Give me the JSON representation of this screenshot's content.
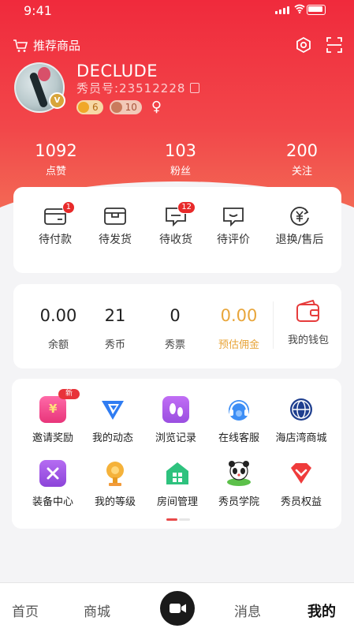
{
  "status_bar": {
    "time": "9:41"
  },
  "header": {
    "recommend_label": "推荐商品"
  },
  "profile": {
    "username": "DECLUDE",
    "id_label": "秀员号:23512228",
    "level_badge": "V",
    "mic_count": "6",
    "diamond_count": "10",
    "gender_symbol": "♀"
  },
  "stats": [
    {
      "value": "1092",
      "label": "点赞"
    },
    {
      "value": "103",
      "label": "粉丝"
    },
    {
      "value": "200",
      "label": "关注"
    }
  ],
  "orders": [
    {
      "label": "待付款",
      "badge": "1",
      "icon": "wallet-card-icon"
    },
    {
      "label": "待发货",
      "badge": "",
      "icon": "box-icon"
    },
    {
      "label": "待收货",
      "badge": "12",
      "icon": "chat-truck-icon"
    },
    {
      "label": "待评价",
      "badge": "",
      "icon": "comment-icon"
    },
    {
      "label": "退换/售后",
      "badge": "",
      "icon": "yen-refresh-icon"
    }
  ],
  "wallet": {
    "items": [
      {
        "value": "0.00",
        "label": "余额"
      },
      {
        "value": "21",
        "label": "秀币"
      },
      {
        "value": "0",
        "label": "秀票"
      },
      {
        "value": "0.00",
        "label": "预估佣金"
      }
    ],
    "my_wallet_label": "我的钱包",
    "highlight_color": "#e8a53a"
  },
  "services": [
    {
      "label": "邀请奖励",
      "icon": "gift-icon",
      "badge": "新"
    },
    {
      "label": "我的动态",
      "icon": "dynamic-icon"
    },
    {
      "label": "浏览记录",
      "icon": "footprint-icon"
    },
    {
      "label": "在线客服",
      "icon": "headset-icon"
    },
    {
      "label": "海店湾商城",
      "icon": "globe-icon"
    },
    {
      "label": "装备中心",
      "icon": "toolbox-icon"
    },
    {
      "label": "我的等级",
      "icon": "trophy-icon"
    },
    {
      "label": "房间管理",
      "icon": "house-icon"
    },
    {
      "label": "秀员学院",
      "icon": "panda-icon"
    },
    {
      "label": "秀员权益",
      "icon": "heart-badge-icon"
    }
  ],
  "tabbar": {
    "items": [
      {
        "label": "首页"
      },
      {
        "label": "商城"
      },
      {
        "label": ""
      },
      {
        "label": "消息"
      },
      {
        "label": "我的"
      }
    ]
  },
  "colors": {
    "brand": "#f02a3c",
    "badge": "#e82a2a",
    "gold": "#e8a53a"
  }
}
